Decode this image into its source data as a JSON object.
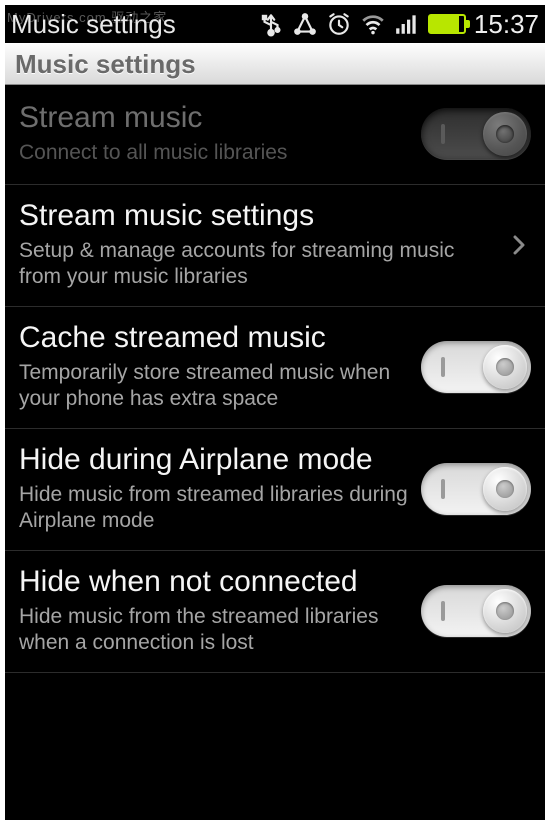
{
  "watermark": "MyDrivers.com 驱动之家",
  "statusbar": {
    "title": "Music settings",
    "time": "15:37"
  },
  "section": {
    "header": "Music settings"
  },
  "rows": [
    {
      "title": "Stream music",
      "subtitle": "Connect to all music libraries",
      "type": "toggle",
      "enabled": false,
      "value": false
    },
    {
      "title": "Stream music settings",
      "subtitle": "Setup & manage accounts for streaming music from your music libraries",
      "type": "nav"
    },
    {
      "title": "Cache streamed music",
      "subtitle": "Temporarily store streamed music when your phone has extra space",
      "type": "toggle",
      "enabled": true,
      "value": true
    },
    {
      "title": "Hide during Airplane mode",
      "subtitle": "Hide music from streamed libraries during Airplane mode",
      "type": "toggle",
      "enabled": true,
      "value": true
    },
    {
      "title": "Hide when not connected",
      "subtitle": "Hide music from the streamed libraries when a connection is lost",
      "type": "toggle",
      "enabled": true,
      "value": true
    }
  ]
}
